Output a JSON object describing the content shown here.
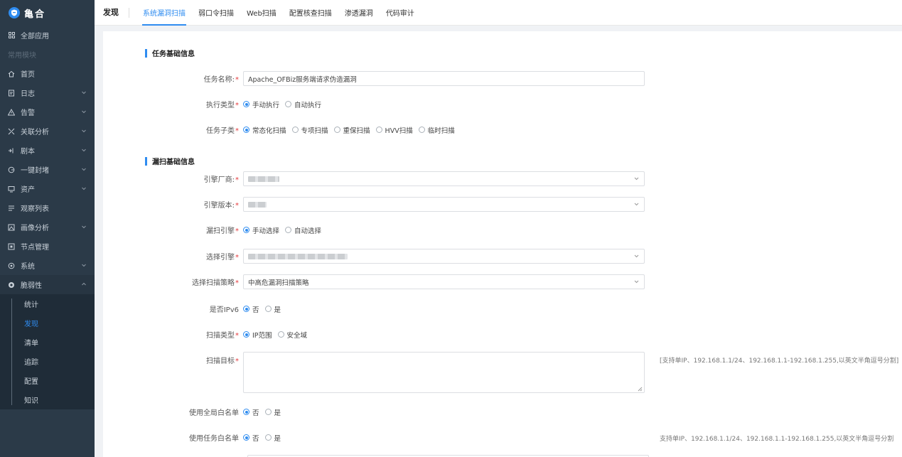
{
  "app": {
    "brand": "亀合"
  },
  "sidebar": {
    "items": [
      {
        "label": "全部应用",
        "icon": "grid-icon",
        "chevron": false
      },
      {
        "section": true,
        "label": "常用模块"
      },
      {
        "label": "首页",
        "icon": "home-icon",
        "chevron": false
      },
      {
        "label": "日志",
        "icon": "log-icon",
        "chevron": true
      },
      {
        "label": "告警",
        "icon": "warning-icon",
        "chevron": true
      },
      {
        "label": "关联分析",
        "icon": "correlation-icon",
        "chevron": true
      },
      {
        "label": "剧本",
        "icon": "playbook-icon",
        "chevron": true
      },
      {
        "label": "一键封堵",
        "icon": "block-icon",
        "chevron": true
      },
      {
        "label": "资产",
        "icon": "monitor-icon",
        "chevron": true
      },
      {
        "label": "观察列表",
        "icon": "list-icon",
        "chevron": false
      },
      {
        "label": "画像分析",
        "icon": "portrait-icon",
        "chevron": true
      },
      {
        "label": "节点管理",
        "icon": "node-icon",
        "chevron": false
      },
      {
        "label": "系统",
        "icon": "settings-icon",
        "chevron": true
      },
      {
        "label": "脆弱性",
        "icon": "vulnerability-icon",
        "chevron": true,
        "open": true
      }
    ],
    "submenu": [
      {
        "label": "统计",
        "active": false
      },
      {
        "label": "发现",
        "active": true
      },
      {
        "label": "清单",
        "active": false
      },
      {
        "label": "追踪",
        "active": false
      },
      {
        "label": "配置",
        "active": false
      },
      {
        "label": "知识",
        "active": false
      }
    ]
  },
  "header": {
    "page_label": "发现",
    "tabs": [
      {
        "label": "系统漏洞扫描",
        "active": true
      },
      {
        "label": "弱口令扫描",
        "active": false
      },
      {
        "label": "Web扫描",
        "active": false
      },
      {
        "label": "配置核查扫描",
        "active": false
      },
      {
        "label": "渗透漏洞",
        "active": false
      },
      {
        "label": "代码审计",
        "active": false
      }
    ]
  },
  "form": {
    "section_basic": "任务基础信息",
    "section_scan": "漏扫基础信息",
    "task_name": {
      "label": "任务名称:",
      "value": "Apache_OFBiz服务端请求伪造漏洞"
    },
    "exec_type": {
      "label": "执行类型",
      "options": [
        "手动执行",
        "自动执行"
      ],
      "selected": 0
    },
    "task_subtype": {
      "label": "任务子类",
      "options": [
        "常态化扫描",
        "专项扫描",
        "重保扫描",
        "HVV扫描",
        "临时扫描"
      ],
      "selected": 0
    },
    "engine_vendor": {
      "label": "引擎厂商:"
    },
    "engine_version": {
      "label": "引擎版本:"
    },
    "scan_engine": {
      "label": "漏扫引擎",
      "options": [
        "手动选择",
        "自动选择"
      ],
      "selected": 0
    },
    "select_engine": {
      "label": "选择引擎"
    },
    "scan_policy": {
      "label": "选择扫描策略",
      "value": "中高危漏洞扫描策略"
    },
    "ipv6": {
      "label": "是否IPv6",
      "options": [
        "否",
        "是"
      ],
      "selected": 0
    },
    "scan_type": {
      "label": "扫描类型",
      "options": [
        "IP范围",
        "安全域"
      ],
      "selected": 0
    },
    "scan_target": {
      "label": "扫描目标",
      "hint": "[支持单IP、192.168.1.1/24、192.168.1.1-192.168.1.255,以英文半角逗号分割]"
    },
    "global_whitelist": {
      "label": "使用全局白名单",
      "options": [
        "否",
        "是"
      ],
      "selected": 0
    },
    "task_whitelist": {
      "label": "使用任务白名单",
      "options": [
        "否",
        "是"
      ],
      "selected": 0,
      "hint": "支持单IP、192.168.1.1/24、192.168.1.1-192.168.1.255,以英文半角逗号分割"
    }
  },
  "colors": {
    "accent": "#2f8cf0",
    "sidebar_bg": "#2b3a48",
    "required": "#e4393c"
  }
}
